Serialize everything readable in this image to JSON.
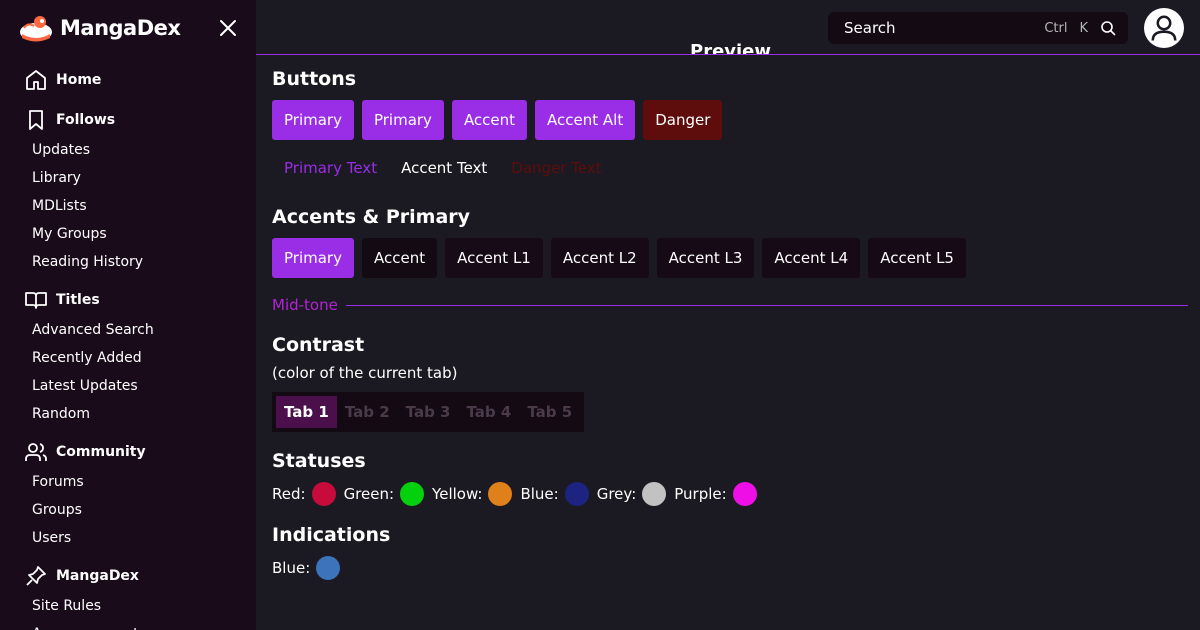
{
  "sidebar": {
    "brand": "MangaDex",
    "sections": [
      {
        "label": "Home",
        "items": []
      },
      {
        "label": "Follows",
        "items": [
          "Updates",
          "Library",
          "MDLists",
          "My Groups",
          "Reading History"
        ]
      },
      {
        "label": "Titles",
        "items": [
          "Advanced Search",
          "Recently Added",
          "Latest Updates",
          "Random"
        ]
      },
      {
        "label": "Community",
        "items": [
          "Forums",
          "Groups",
          "Users"
        ]
      },
      {
        "label": "MangaDex",
        "items": [
          "Site Rules",
          "Announcements"
        ]
      }
    ]
  },
  "topbar": {
    "search_placeholder": "Search",
    "shortcut_ctrl": "Ctrl",
    "shortcut_key": "K",
    "preview_peek": "Preview"
  },
  "main": {
    "buttons": {
      "title": "Buttons",
      "items": [
        "Primary",
        "Primary",
        "Accent",
        "Accent Alt",
        "Danger"
      ],
      "text_items": [
        "Primary Text",
        "Accent Text",
        "Danger Text"
      ]
    },
    "accents": {
      "title": "Accents & Primary",
      "items": [
        "Primary",
        "Accent",
        "Accent L1",
        "Accent L2",
        "Accent L3",
        "Accent L4",
        "Accent L5"
      ],
      "midtone": "Mid-tone"
    },
    "contrast": {
      "title": "Contrast",
      "subtitle": "(color of the current tab)",
      "tabs": [
        "Tab 1",
        "Tab 2",
        "Tab 3",
        "Tab 4",
        "Tab 5"
      ]
    },
    "statuses": {
      "title": "Statuses",
      "items": [
        {
          "label": "Red:",
          "color": "#c70c3b"
        },
        {
          "label": "Green:",
          "color": "#03d10d"
        },
        {
          "label": "Yellow:",
          "color": "#e0801a"
        },
        {
          "label": "Blue:",
          "color": "#1d2380"
        },
        {
          "label": "Grey:",
          "color": "#c2c2c2"
        },
        {
          "label": "Purple:",
          "color": "#ee0ee6"
        }
      ]
    },
    "indications": {
      "title": "Indications",
      "items": [
        {
          "label": "Blue:",
          "color": "#3d73ba"
        }
      ]
    }
  },
  "colors": {
    "primary": "#9a2de6",
    "accent": "#130a13",
    "danger": "#5e0c0c",
    "primary_text": "#9a2de6",
    "danger_text": "#5e0c0c",
    "midtone": "#b521d8"
  }
}
